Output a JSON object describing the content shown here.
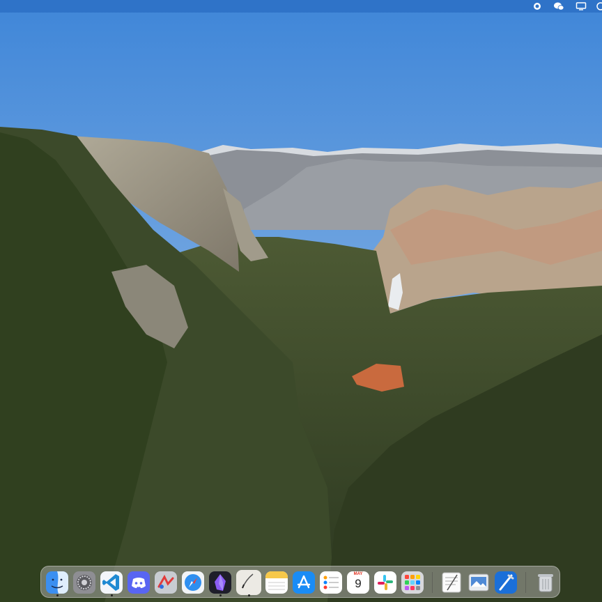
{
  "desktop": {
    "wallpaper": "mountain-valley-landscape"
  },
  "menubar": {
    "color": "#2f73c8",
    "status_icons": [
      "record-icon",
      "wechat-icon",
      "display-icon",
      "control-center-icon"
    ]
  },
  "dock": {
    "apps": [
      {
        "name": "finder",
        "running": true
      },
      {
        "name": "system-settings",
        "running": false
      },
      {
        "name": "visual-studio-code",
        "running": true
      },
      {
        "name": "discord",
        "running": false
      },
      {
        "name": "mindmap-app",
        "running": false
      },
      {
        "name": "safari",
        "running": false
      },
      {
        "name": "obsidian",
        "running": true
      },
      {
        "name": "script-editor",
        "running": true
      },
      {
        "name": "notes",
        "running": false
      },
      {
        "name": "app-store",
        "running": false
      },
      {
        "name": "reminders",
        "running": false
      },
      {
        "name": "calendar",
        "running": false
      },
      {
        "name": "slack",
        "running": false
      },
      {
        "name": "launchpad",
        "running": false
      },
      {
        "name": "textedit",
        "running": false
      },
      {
        "name": "preview",
        "running": false
      },
      {
        "name": "xcode",
        "running": false
      },
      {
        "name": "trash",
        "running": false
      }
    ],
    "calendar": {
      "month": "MAY",
      "day": "9"
    }
  }
}
